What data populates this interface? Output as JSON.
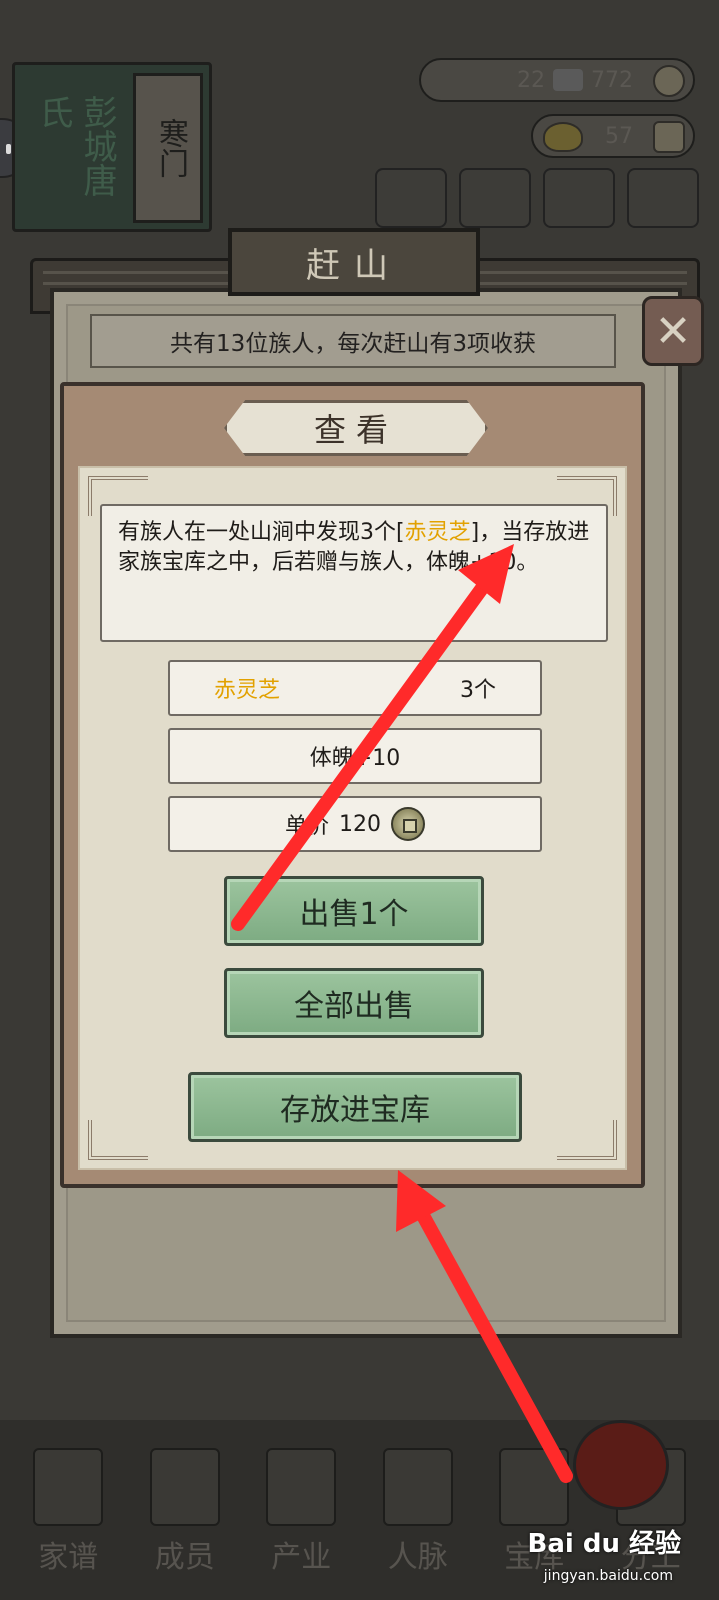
{
  "header": {
    "clan_name": "彭城",
    "clan_surname": "唐氏",
    "title_card": "寒门",
    "silver_count": "22",
    "copper_count": "772",
    "gold_count": "57"
  },
  "dialog": {
    "title": "赶山",
    "info_text": "共有13位族人，每次赶山有3项收获",
    "close_symbol": "✕"
  },
  "view_panel": {
    "title": "查看",
    "description_prefix": "有族人在一处山涧中发现3个[",
    "description_item": "赤灵芝",
    "description_suffix": "]，当存放进家族宝库之中，后若赠与族人，体魄+10。",
    "item_name": "赤灵芝",
    "item_count": "3个",
    "effect": "体魄+10",
    "price_label": "单价",
    "price_value": "120",
    "price_icon": "copper-coin-icon",
    "sell_one_label": "出售1个",
    "sell_all_label": "全部出售",
    "store_label": "存放进宝库"
  },
  "bottom_nav": {
    "items": [
      {
        "label": "家谱"
      },
      {
        "label": "成员"
      },
      {
        "label": "产业"
      },
      {
        "label": "人脉"
      },
      {
        "label": "宝库"
      },
      {
        "label": "分工"
      }
    ]
  },
  "watermark": {
    "brand": "Bai du 经验",
    "url": "jingyan.baidu.com"
  },
  "colors": {
    "highlight": "#e2a100",
    "annotation_arrow": "#ff2a2a",
    "button_green": "#8fb992"
  }
}
